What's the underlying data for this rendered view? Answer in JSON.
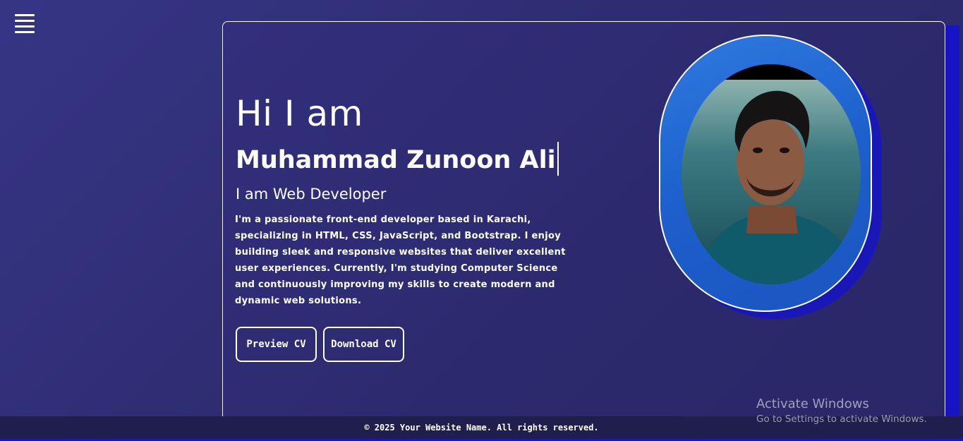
{
  "nav": {
    "menu_icon": "hamburger-menu-icon"
  },
  "hero": {
    "greeting": "Hi I am",
    "name": "Muhammad Zunoon Ali",
    "role": "I am Web Developer",
    "bio": "I'm a passionate front-end developer based in Karachi, specializing in HTML, CSS, JavaScript, and Bootstrap. I enjoy building sleek and responsive websites that deliver excellent user experiences. Currently, I'm studying Computer Science and continuously improving my skills to create modern and dynamic web solutions.",
    "buttons": {
      "preview": "Preview CV",
      "download": "Download CV"
    }
  },
  "profile": {
    "photo_icon": "profile-photo"
  },
  "footer": {
    "text": "© 2025 Your Website Name. All rights reserved."
  },
  "watermark": {
    "title": "Activate Windows",
    "subtitle": "Go to Settings to activate Windows."
  },
  "colors": {
    "background": "#363585",
    "accent_blue": "#1814c4",
    "frame_blue": "#2f7ae0",
    "footer": "#1f1e4d"
  }
}
